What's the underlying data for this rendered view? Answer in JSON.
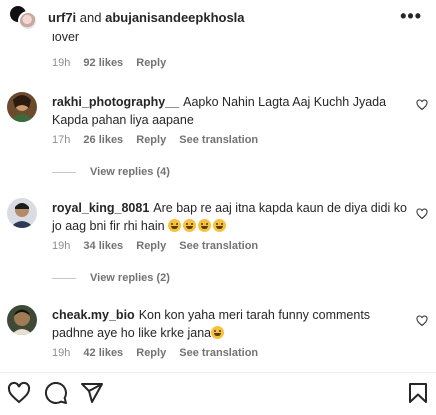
{
  "header": {
    "user1": "urf7i",
    "conj": " and ",
    "user2": "abujanisandeepkhosla",
    "more": "•••"
  },
  "top_partial": {
    "text": "lover",
    "age": "19h",
    "likes": "92 likes",
    "reply": "Reply"
  },
  "comments": [
    {
      "username": "rakhi_photography__",
      "text": "Aapko Nahin Lagta Aaj Kuchh Jyada Kapda pahan liya aapane",
      "age": "17h",
      "likes": "26 likes",
      "reply": "Reply",
      "translation": "See translation",
      "view_replies": "View replies (4)"
    },
    {
      "username": "royal_king_8081",
      "text": "Are bap re aaj itna kapda kaun de diya didi ko jo aag bni fir rhi hain",
      "age": "19h",
      "likes": "34 likes",
      "reply": "Reply",
      "translation": "See translation",
      "view_replies": "View replies (2)"
    },
    {
      "username": "cheak.my_bio",
      "text": "Kon kon yaha meri tarah funny comments padhne aye ho like krke jana",
      "age": "19h",
      "likes": "42 likes",
      "reply": "Reply",
      "translation": "See translation"
    }
  ],
  "icons": {
    "like": "heart-icon",
    "comment": "comment-icon",
    "share": "share-icon",
    "save": "bookmark-icon",
    "emoji": "grinning-face-emoji"
  }
}
